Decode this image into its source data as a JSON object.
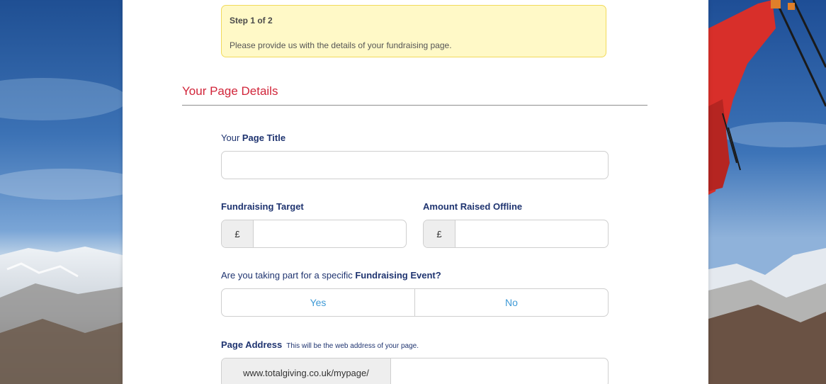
{
  "step": {
    "title": "Step 1 of 2",
    "text": "Please provide us with the details of your fundraising page."
  },
  "section": {
    "title": "Your Page Details"
  },
  "page_title_field": {
    "label_prefix": "Your ",
    "label_bold": "Page Title",
    "value": "",
    "placeholder": ""
  },
  "target_field": {
    "label": "Fundraising Target",
    "currency": "£",
    "value": ""
  },
  "offline_field": {
    "label": "Amount Raised Offline",
    "currency": "£",
    "value": ""
  },
  "event_question": {
    "prefix": "Are you taking part for a specific ",
    "bold": "Fundraising Event?",
    "yes_label": "Yes",
    "no_label": "No"
  },
  "page_address": {
    "label": "Page Address",
    "hint": "This will be the web address of your page.",
    "url_prefix": "www.totalgiving.co.uk/mypage/",
    "value": ""
  },
  "colors": {
    "accent_red": "#d1253a",
    "label_navy": "#1f3470",
    "toggle_blue": "#3f9ad6",
    "notice_bg": "#fff9c7",
    "notice_border": "#f1da5b"
  }
}
